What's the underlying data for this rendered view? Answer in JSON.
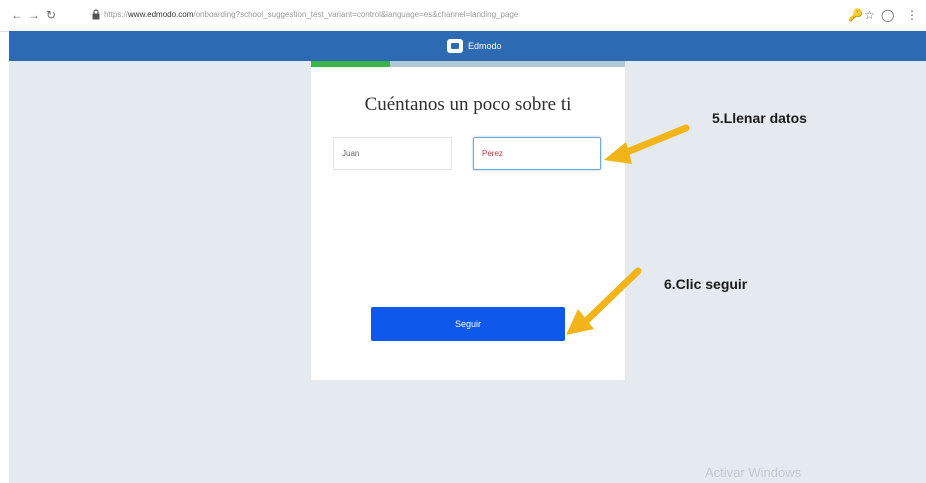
{
  "browser": {
    "back_icon": "arrow-left-icon",
    "forward_icon": "arrow-right-icon",
    "reload_icon": "reload-icon",
    "url_prefix": "https://",
    "url_domain": "www.edmodo.com",
    "url_path": "/onboarding?school_suggestion_test_variant=control&language=es&channel=landing_page"
  },
  "header": {
    "brand_name": "Edmodo",
    "color": "#2c6bb4"
  },
  "onboarding": {
    "progress_fraction": 0.25,
    "progress_color": "#3db44a",
    "title": "Cuéntanos un poco sobre ti",
    "first_name_value": "Juan",
    "last_name_value": "Perez",
    "submit_label": "Seguir",
    "submit_color": "#0e58ec"
  },
  "annotations": {
    "step5": "5.Llenar datos",
    "step6": "6.Clic seguir",
    "arrow_color": "#f2b418"
  },
  "watermark": "Activar Windows"
}
